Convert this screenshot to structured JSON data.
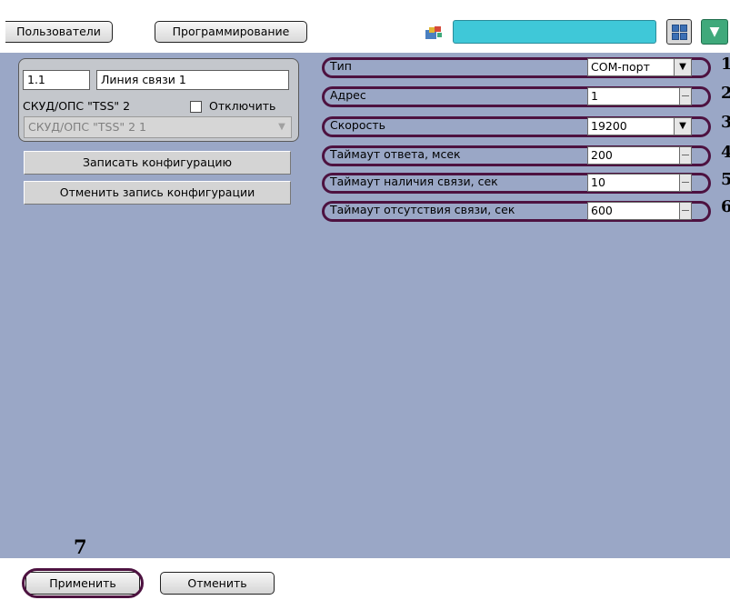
{
  "toolbar": {
    "users_tab": "Пользователи",
    "programming_tab": "Программирование",
    "colors": {
      "cyan_field": "#3fc8d8",
      "green_button": "#3fa97b"
    }
  },
  "object_group": {
    "id_value": "1.1",
    "name_value": "Линия связи 1",
    "parent_label": "СКУД/ОПС \"TSS\" 2",
    "disable_label": "Отключить",
    "disable_checked": false,
    "parent_combo_value": "СКУД/ОПС \"TSS\" 2 1"
  },
  "buttons": {
    "write_config": "Записать конфигурацию",
    "cancel_write_config": "Отменить запись конфигурации"
  },
  "properties": [
    {
      "name": "Тип",
      "value": "COM-порт",
      "control": "dropdown",
      "callout": "1"
    },
    {
      "name": "Адрес",
      "value": "1",
      "control": "spin",
      "callout": "2"
    },
    {
      "name": "Скорость",
      "value": "19200",
      "control": "dropdown",
      "callout": "3"
    },
    {
      "name": "Таймаут ответа, мсек",
      "value": "200",
      "control": "spin",
      "callout": "4"
    },
    {
      "name": "Таймаут наличия связи, сек",
      "value": "10",
      "control": "spin",
      "callout": "5"
    },
    {
      "name": "Таймаут отсутствия связи, сек",
      "value": "600",
      "control": "spin",
      "callout": "6"
    }
  ],
  "footer": {
    "apply": "Применить",
    "cancel": "Отменить",
    "apply_callout": "7"
  },
  "colors": {
    "panel_bg": "#9aa7c6",
    "callout_oval": "#4d1240"
  }
}
